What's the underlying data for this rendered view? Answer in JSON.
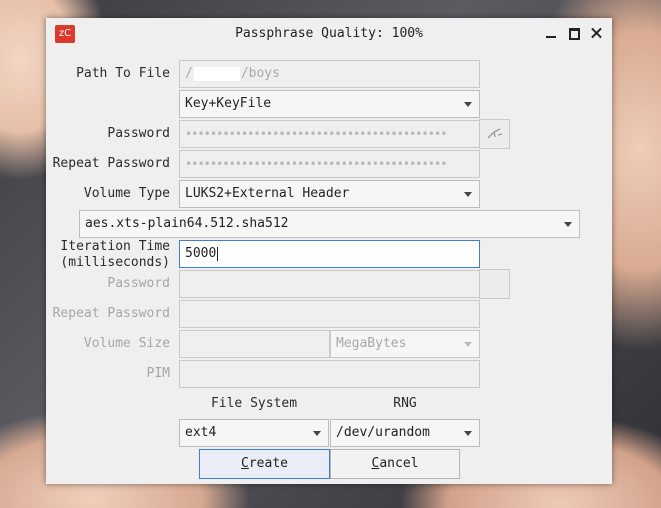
{
  "window": {
    "icon_text": "zC",
    "title": "Passphrase Quality: 100%"
  },
  "form": {
    "path_label": "Path To File",
    "path_value_prefix": "/",
    "path_value_suffix": "/boys",
    "key_type": "Key+KeyFile",
    "password_label": "Password",
    "password_dots": "••••••••••••••••••••••••••••••••••••••••••",
    "repeat_password_label": "Repeat Password",
    "repeat_password_dots": "••••••••••••••••••••••••••••••••••••••••••",
    "volume_type_label": "Volume Type",
    "volume_type": "LUKS2+External Header",
    "cipher": "aes.xts-plain64.512.sha512",
    "iteration_label_line1": "Iteration Time",
    "iteration_label_line2": "(milliseconds)",
    "iteration_value": "5000",
    "hidden_password_label": "Password",
    "hidden_repeat_password_label": "Repeat Password",
    "volume_size_label": "Volume Size",
    "volume_size_unit": "MegaBytes",
    "pim_label": "PIM",
    "file_system_label": "File System",
    "rng_label": "RNG",
    "file_system": "ext4",
    "rng": "/dev/urandom"
  },
  "buttons": {
    "create_mnemonic": "C",
    "create_rest": "reate",
    "cancel_mnemonic": "C",
    "cancel_rest": "ancel"
  },
  "icons": {
    "app": "zulucrypt-logo-icon",
    "key": "key-icon"
  },
  "colors": {
    "app_icon": "#d93a2b",
    "focus_border": "#3f7fcf"
  }
}
